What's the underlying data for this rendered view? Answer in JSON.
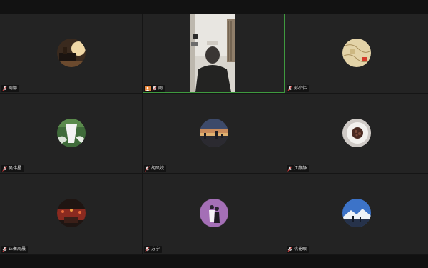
{
  "meeting": {
    "layout": "gallery-3x3",
    "active_speaker_border_color": "#3f9a3f",
    "participants": [
      {
        "name": "周娜",
        "mic": "muted-icon",
        "avatar": "piano-room-photo"
      },
      {
        "name": "雨",
        "mic": "muted-icon",
        "video": "on",
        "host_badge": "host-icon"
      },
      {
        "name": "彭小伟",
        "mic": "muted-icon",
        "avatar": "map-photo"
      },
      {
        "name": "吴伟星",
        "mic": "muted-icon",
        "avatar": "waterfall-photo"
      },
      {
        "name": "胡凤姣",
        "mic": "muted-icon",
        "avatar": "city-sunset-photo"
      },
      {
        "name": "江静静",
        "mic": "muted-icon",
        "avatar": "chocolate-plate-photo"
      },
      {
        "name": "正衡周晨",
        "mic": "muted-icon",
        "avatar": "red-lights-photo"
      },
      {
        "name": "方宁",
        "mic": "muted-icon",
        "avatar": "couple-purple-photo"
      },
      {
        "name": "桃花眼",
        "mic": "muted-icon",
        "avatar": "snow-mountain-photo"
      }
    ]
  }
}
